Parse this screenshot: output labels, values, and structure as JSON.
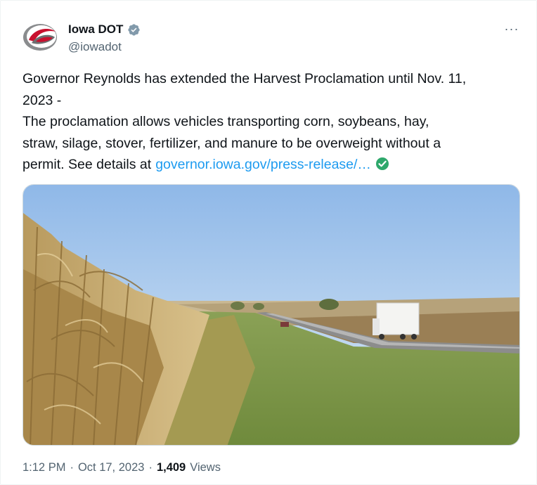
{
  "author": {
    "display_name": "Iowa DOT",
    "handle": "@iowadot",
    "verified_icon": "verified-badge-icon",
    "avatar_icon": "iowa-dot-logo-icon"
  },
  "more_label": "···",
  "tweet": {
    "line1": "Governor Reynolds has extended the Harvest Proclamation until Nov. 11,",
    "line2": "2023 -",
    "line3": "The proclamation allows vehicles transporting corn, soybeans, hay,",
    "line4": "straw, silage, stover, fertilizer, and manure to be overweight without a",
    "line5_prefix": "permit. See details at",
    "link_text": "governor.iowa.gov/press-release/…",
    "emoji_icon": "check-mark-button-icon"
  },
  "media": {
    "icon": "cornfield-highway-photo"
  },
  "meta": {
    "time": "1:12 PM",
    "sep1": "·",
    "date": "Oct 17, 2023",
    "sep2": "·",
    "views_count": "1,409",
    "views_label": "Views"
  },
  "colors": {
    "link": "#1d9bf0",
    "secondary_text": "#536471",
    "verified": "#829aab",
    "check_emoji": "#2ea86b"
  }
}
